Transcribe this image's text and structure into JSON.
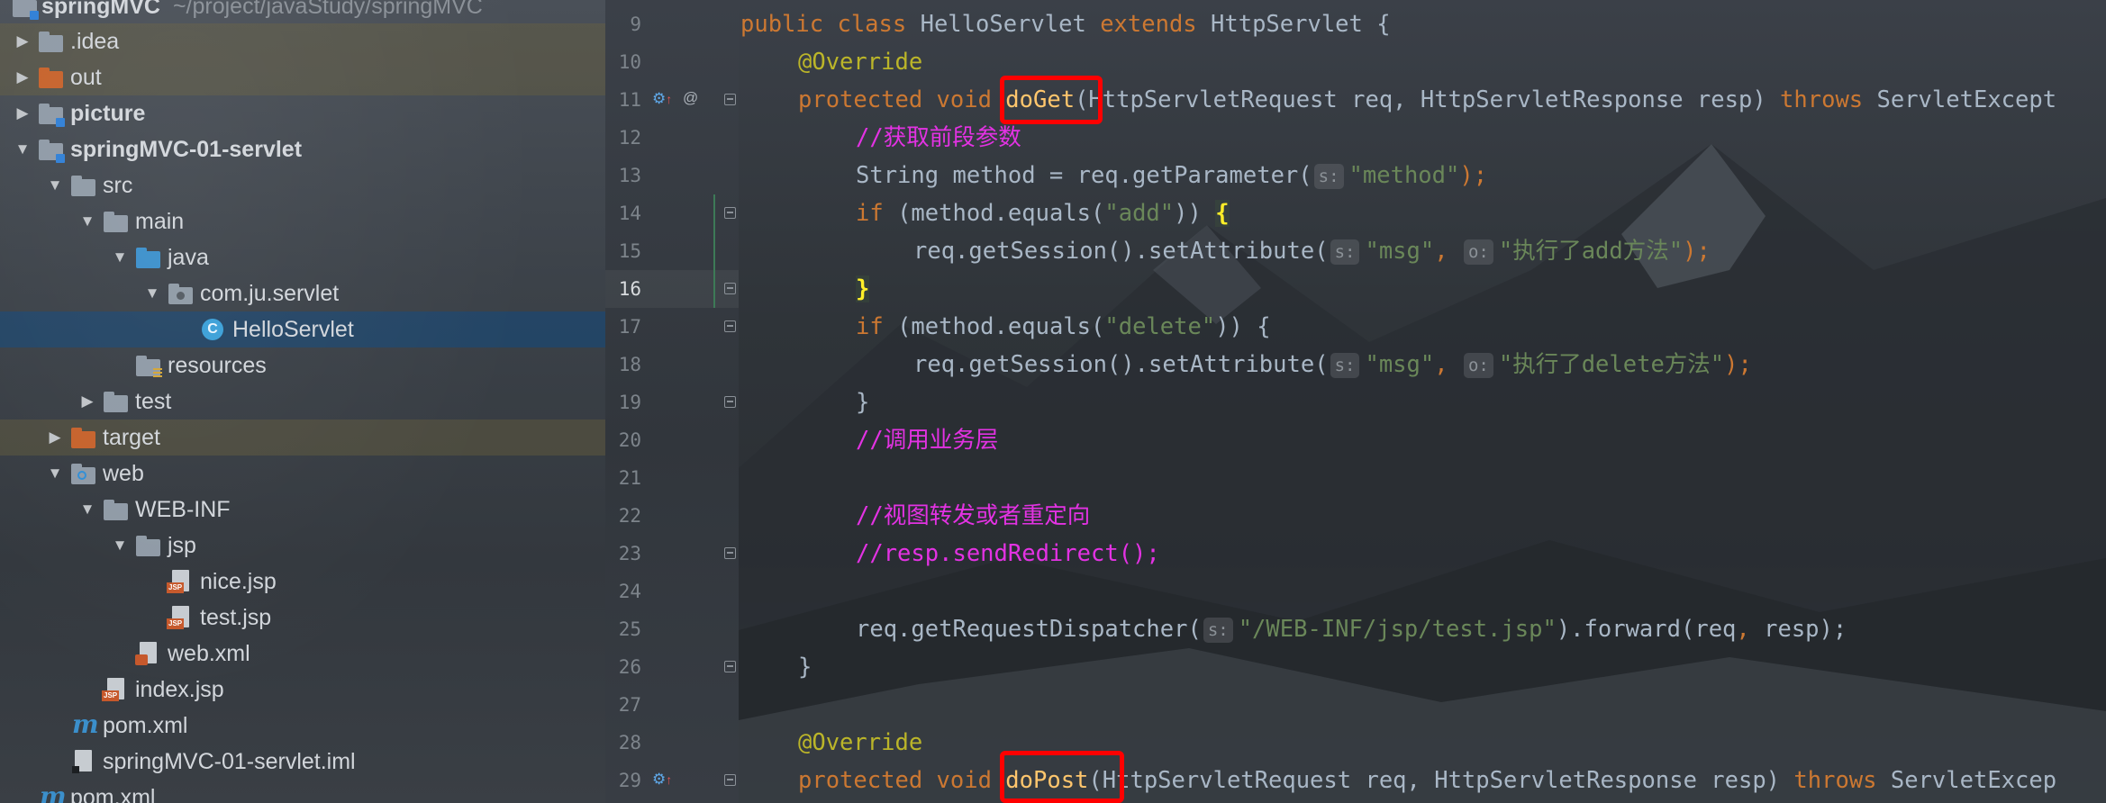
{
  "project": {
    "name": "springMVC",
    "path": "~/project/javaStudy/springMVC"
  },
  "tree": [
    {
      "label": ".idea",
      "icon": "folder-icon"
    },
    {
      "label": "out",
      "icon": "excluded-folder-icon"
    },
    {
      "label": "picture",
      "icon": "module-folder-icon"
    },
    {
      "label": "springMVC-01-servlet",
      "icon": "module-folder-icon"
    },
    {
      "label": "src",
      "icon": "folder-icon"
    },
    {
      "label": "main",
      "icon": "folder-icon"
    },
    {
      "label": "java",
      "icon": "source-folder-icon"
    },
    {
      "label": "com.ju.servlet",
      "icon": "package-icon"
    },
    {
      "label": "HelloServlet",
      "icon": "class-icon"
    },
    {
      "label": "resources",
      "icon": "resources-folder-icon"
    },
    {
      "label": "test",
      "icon": "folder-icon"
    },
    {
      "label": "target",
      "icon": "excluded-folder-icon"
    },
    {
      "label": "web",
      "icon": "web-folder-icon"
    },
    {
      "label": "WEB-INF",
      "icon": "folder-icon"
    },
    {
      "label": "jsp",
      "icon": "folder-icon"
    },
    {
      "label": "nice.jsp",
      "icon": "jsp-file-icon"
    },
    {
      "label": "test.jsp",
      "icon": "jsp-file-icon"
    },
    {
      "label": "web.xml",
      "icon": "xml-file-icon"
    },
    {
      "label": "index.jsp",
      "icon": "jsp-file-icon"
    },
    {
      "label": "pom.xml",
      "icon": "maven-icon"
    },
    {
      "label": "springMVC-01-servlet.iml",
      "icon": "iml-file-icon"
    },
    {
      "label": "pom.xml",
      "icon": "maven-icon"
    }
  ],
  "icon_tags": {
    "jsp": "JSP"
  },
  "gutter": {
    "line_numbers": [
      "9",
      "10",
      "11",
      "12",
      "13",
      "14",
      "15",
      "16",
      "17",
      "18",
      "19",
      "20",
      "21",
      "22",
      "23",
      "24",
      "25",
      "26",
      "27",
      "28",
      "29"
    ],
    "override_icon": "⚙↑",
    "annotation_icon": "@"
  },
  "code": {
    "l9": {
      "kw1": "public class ",
      "name": "HelloServlet ",
      "kw2": "extends ",
      "rest": "HttpServlet {"
    },
    "l10": {
      "annotation": "@Override"
    },
    "l11": {
      "kw": "protected void ",
      "method": "doGet",
      "params": "(HttpServletRequest req, HttpServletResponse resp) ",
      "throws": "throws ",
      "exception": "ServletExcept"
    },
    "l12": {
      "comment": "//获取前段参数"
    },
    "l13": {
      "pre": "String method = req.getParameter(",
      "hint": "s:",
      "str": "\"method\"",
      "post": ");"
    },
    "l14": {
      "kw": "if ",
      "pre": "(method.equals(",
      "str": "\"add\"",
      "post": ")) ",
      "brace": "{"
    },
    "l15": {
      "pre": "req.getSession().setAttribute(",
      "hint1": "s:",
      "str1": "\"msg\"",
      "comma": ", ",
      "hint2": "o:",
      "str2": "\"执行了add方法\"",
      "post": ");"
    },
    "l16": {
      "brace": "}"
    },
    "l17": {
      "kw": "if ",
      "pre": "(method.equals(",
      "str": "\"delete\"",
      "post": ")) {"
    },
    "l18": {
      "pre": "req.getSession().setAttribute(",
      "hint1": "s:",
      "str1": "\"msg\"",
      "comma": ", ",
      "hint2": "o:",
      "str2": "\"执行了delete方法\"",
      "post": ");"
    },
    "l19": {
      "text": "}"
    },
    "l20": {
      "comment": "//调用业务层"
    },
    "l22": {
      "comment": "//视图转发或者重定向"
    },
    "l23": {
      "comment": "//resp.sendRedirect();"
    },
    "l25": {
      "pre": "req.getRequestDispatcher(",
      "hint": "s:",
      "str": "\"/WEB-INF/jsp/test.jsp\"",
      "post1": ").forward(req",
      "comma": ", ",
      "post2": "resp);"
    },
    "l26": {
      "text": "}"
    },
    "l28": {
      "annotation": "@Override"
    },
    "l29": {
      "kw": "protected void ",
      "method": "doPost",
      "params": "(HttpServletRequest req, HttpServletResponse resp) ",
      "throws": "throws ",
      "exception": "ServletExcep"
    }
  },
  "colors": {
    "keyword": "#cc7832",
    "string": "#6a8759",
    "comment": "#e332e3",
    "method_decl": "#ffc66d",
    "annotation": "#bbb529",
    "highlight_box": "#ff0000",
    "selection": "#1e466e"
  }
}
